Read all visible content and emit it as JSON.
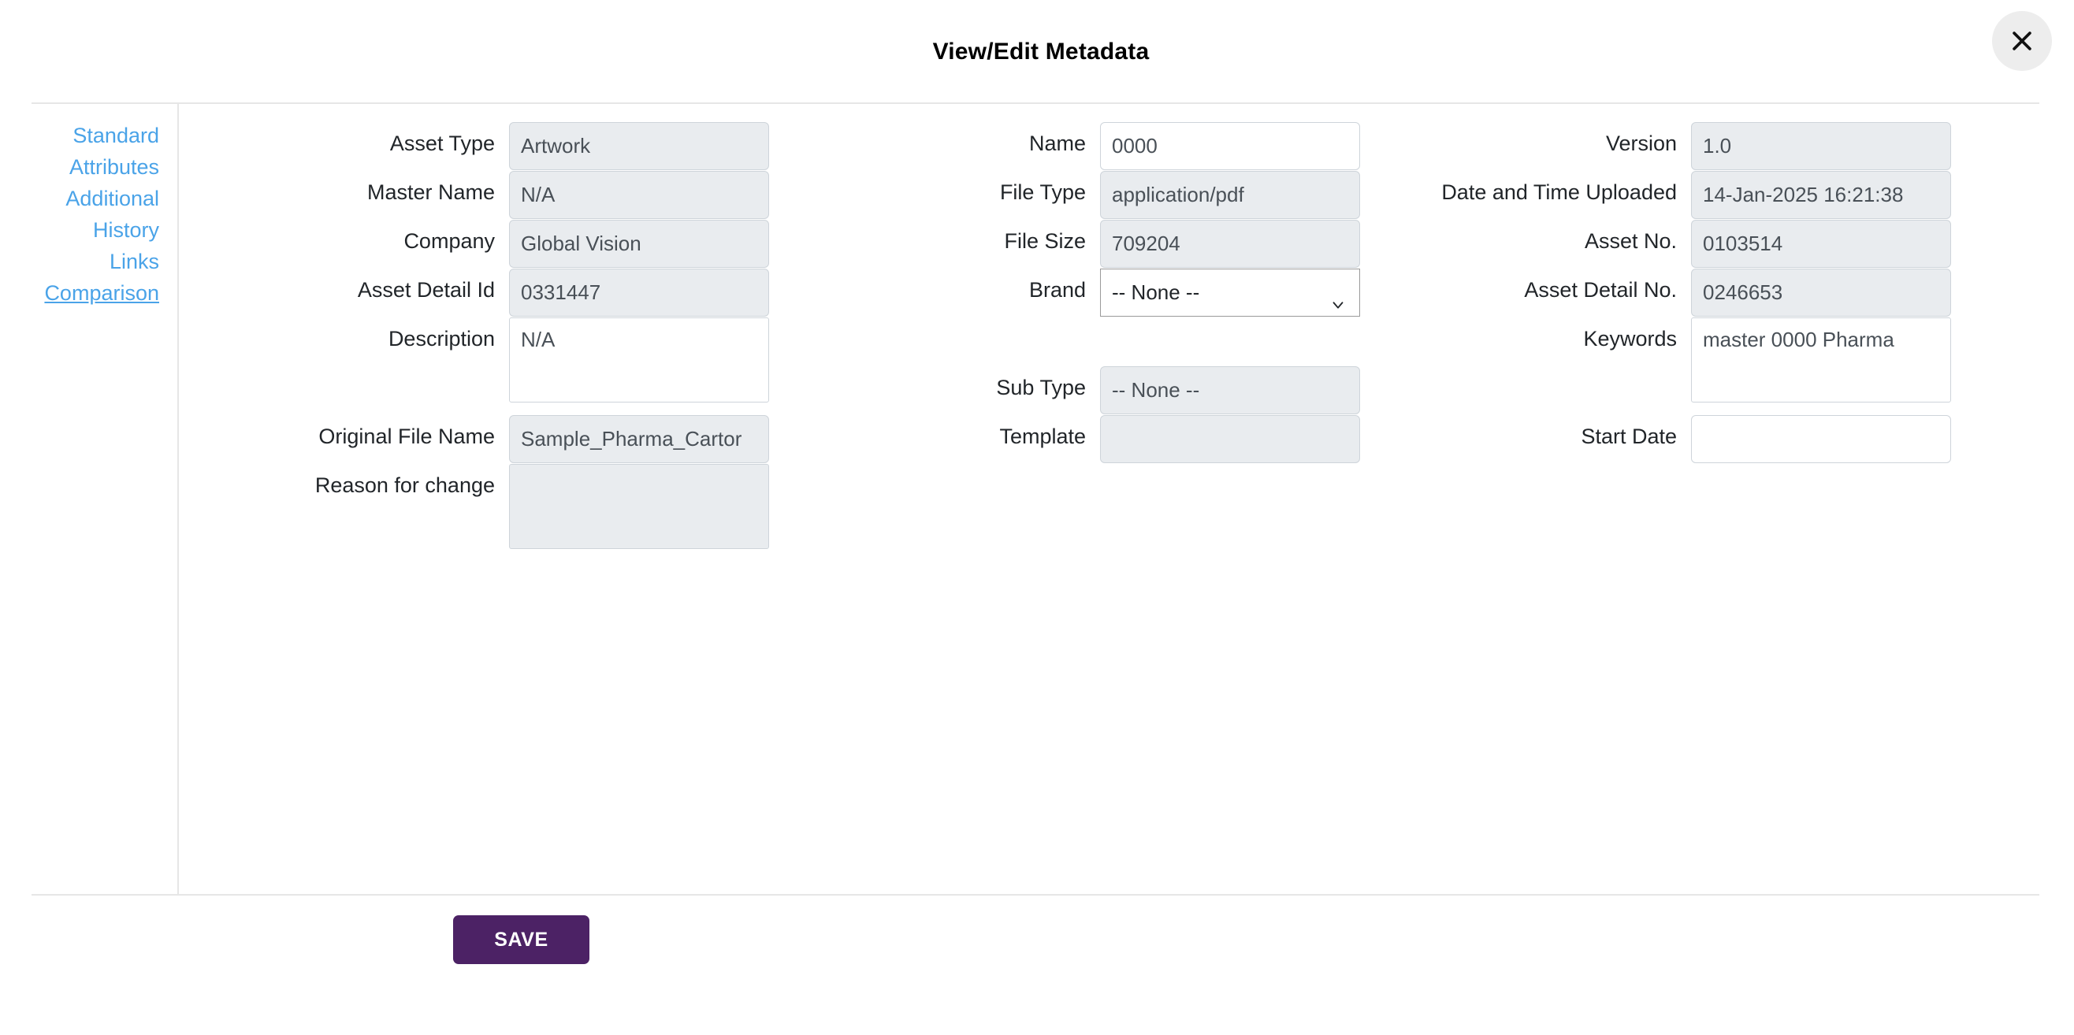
{
  "header": {
    "title": "View/Edit Metadata",
    "close_icon": "close-icon"
  },
  "sidebar": {
    "items": [
      {
        "label": "Standard",
        "active": false
      },
      {
        "label": "Attributes",
        "active": false
      },
      {
        "label": "Additional",
        "active": false
      },
      {
        "label": "History",
        "active": false
      },
      {
        "label": "Links",
        "active": false
      },
      {
        "label": "Comparison",
        "active": true
      }
    ]
  },
  "form": {
    "columns": [
      {
        "name": "column-left",
        "fields": [
          {
            "label": "Asset Type",
            "value": "Artwork",
            "type": "text",
            "disabled": true,
            "placeholder": ""
          },
          {
            "label": "Master Name",
            "value": "N/A",
            "type": "text",
            "disabled": true,
            "placeholder": ""
          },
          {
            "label": "Company",
            "value": "Global Vision",
            "type": "text",
            "disabled": true,
            "placeholder": ""
          },
          {
            "label": "Asset Detail Id",
            "value": "0331447",
            "type": "text",
            "disabled": true,
            "placeholder": ""
          },
          {
            "label": "Description",
            "value": "N/A",
            "type": "textarea",
            "disabled": false,
            "placeholder": ""
          },
          {
            "label": "Original File Name",
            "value": "Sample_Pharma_Cartor",
            "type": "text",
            "disabled": true,
            "placeholder": ""
          },
          {
            "label": "Reason for change",
            "value": "",
            "type": "textarea",
            "disabled": true,
            "placeholder": ""
          }
        ]
      },
      {
        "name": "column-middle",
        "fields": [
          {
            "label": "Name",
            "value": "0000",
            "type": "text",
            "disabled": false,
            "placeholder": ""
          },
          {
            "label": "File Type",
            "value": "application/pdf",
            "type": "text",
            "disabled": true,
            "placeholder": ""
          },
          {
            "label": "File Size",
            "value": "709204",
            "type": "text",
            "disabled": true,
            "placeholder": ""
          },
          {
            "label": "Brand",
            "value": "-- None --",
            "type": "select",
            "disabled": false,
            "placeholder": "",
            "options": [
              "-- None --"
            ]
          },
          {
            "label": "Sub Type",
            "value": "-- None --",
            "type": "text",
            "disabled": true,
            "placeholder": ""
          },
          {
            "label": "Template",
            "value": "",
            "type": "text",
            "disabled": true,
            "placeholder": ""
          }
        ]
      },
      {
        "name": "column-right",
        "fields": [
          {
            "label": "Version",
            "value": "1.0",
            "type": "text",
            "disabled": true,
            "placeholder": ""
          },
          {
            "label": "Date and Time Uploaded",
            "value": "14-Jan-2025 16:21:38",
            "type": "text",
            "disabled": true,
            "placeholder": ""
          },
          {
            "label": "Asset No.",
            "value": "0103514",
            "type": "text",
            "disabled": true,
            "placeholder": ""
          },
          {
            "label": "Asset Detail No.",
            "value": "0246653",
            "type": "text",
            "disabled": true,
            "placeholder": ""
          },
          {
            "label": "Keywords",
            "value": "master 0000 Pharma",
            "type": "textarea",
            "disabled": false,
            "placeholder": ""
          },
          {
            "label": "Start Date",
            "value": "",
            "type": "text",
            "disabled": false,
            "placeholder": ""
          }
        ]
      }
    ]
  },
  "footer": {
    "save_label": "SAVE"
  },
  "colors": {
    "accent_purple": "#4c2265",
    "link_blue": "#4aa3e8",
    "disabled_bg": "#e9ecef",
    "border": "#ced4da",
    "rule": "#e6e6e6"
  }
}
